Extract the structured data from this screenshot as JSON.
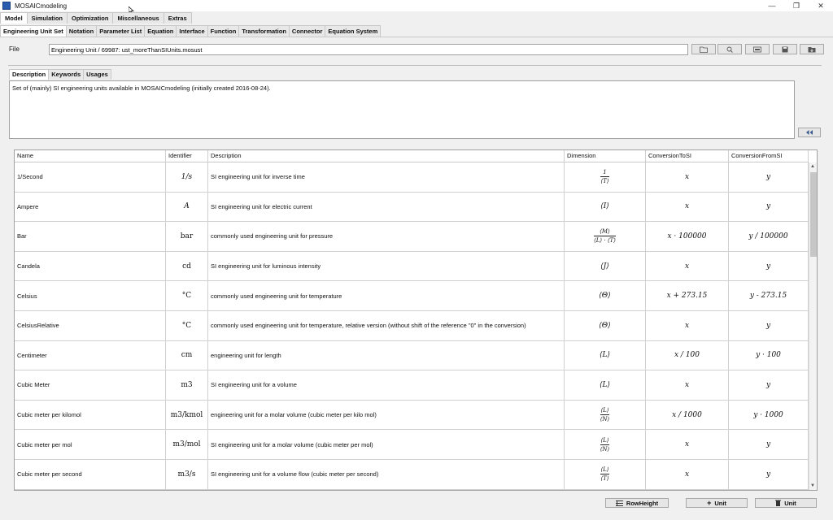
{
  "window": {
    "title": "MOSAICmodeling",
    "minimize": "—",
    "restore": "❐",
    "close": "✕"
  },
  "menu_tabs": [
    "Model",
    "Simulation",
    "Optimization",
    "Miscellaneous",
    "Extras"
  ],
  "sub_tabs": [
    "Engineering Unit Set",
    "Notation",
    "Parameter List",
    "Equation",
    "Interface",
    "Function",
    "Transformation",
    "Connector",
    "Equation System"
  ],
  "file": {
    "label": "File",
    "value": "Engineering Unit / 69987: ust_moreThanSIUnits.mosust"
  },
  "desc_tabs": [
    "Description",
    "Keywords",
    "Usages"
  ],
  "description": "Set of (mainly) SI engineering units available in MOSAICmodeling (initially created 2016-08-24).",
  "table": {
    "headers": [
      "Name",
      "Identifier",
      "Description",
      "Dimension",
      "ConversionToSI",
      "ConversionFromSI"
    ],
    "rows": [
      {
        "name": "1/Second",
        "identifier": "1/s",
        "description": "SI engineering unit for inverse time",
        "to_si": "x",
        "from_si": "y"
      },
      {
        "name": "Ampere",
        "identifier": "A",
        "description": "SI engineering unit for electric current",
        "to_si": "x",
        "from_si": "y"
      },
      {
        "name": "Bar",
        "identifier": "bar",
        "description": "commonly used engineering unit for pressure",
        "to_si": "x · 100000",
        "from_si": "y / 100000"
      },
      {
        "name": "Candela",
        "identifier": "cd",
        "description": "SI engineering unit for luminous intensity",
        "to_si": "x",
        "from_si": "y"
      },
      {
        "name": "Celsius",
        "identifier": "°C",
        "description": "commonly used engineering unit for temperature",
        "to_si": "x + 273.15",
        "from_si": "y - 273.15"
      },
      {
        "name": "CelsiusRelative",
        "identifier": "°C",
        "description": "commonly used engineering unit for temperature, relative version (without shift of the reference \"0\" in the conversion)",
        "to_si": "x",
        "from_si": "y"
      },
      {
        "name": "Centimeter",
        "identifier": "cm",
        "description": "engineering unit for length",
        "to_si": "x / 100",
        "from_si": "y · 100"
      },
      {
        "name": "Cubic Meter",
        "identifier": "m3",
        "description": "SI engineering unit for a volume",
        "to_si": "x",
        "from_si": "y"
      },
      {
        "name": "Cubic meter per kilomol",
        "identifier": "m3/kmol",
        "description": "engineering unit for a molar volume (cubic meter per kilo mol)",
        "to_si": "x / 1000",
        "from_si": "y · 1000"
      },
      {
        "name": "Cubic meter per mol",
        "identifier": "m3/mol",
        "description": "SI engineering unit for a molar volume (cubic meter per mol)",
        "to_si": "x",
        "from_si": "y"
      },
      {
        "name": "Cubic meter per second",
        "identifier": "m3/s",
        "description": "SI engineering unit for a volume flow (cubic meter per second)",
        "to_si": "x",
        "from_si": "y"
      }
    ],
    "dimensions": {
      "r0": {
        "num": "1",
        "den": "⟨T⟩"
      },
      "r1": "⟨I⟩",
      "r2": {
        "num": "⟨M⟩",
        "den": "⟨L⟩ · ⟨T⟩"
      },
      "r3": "⟨J⟩",
      "r4": "⟨Θ⟩",
      "r5": "⟨Θ⟩",
      "r6": "⟨L⟩",
      "r7": "⟨L⟩",
      "r8": {
        "num": "⟨L⟩",
        "den": "⟨N⟩"
      },
      "r9": {
        "num": "⟨L⟩",
        "den": "⟨N⟩"
      },
      "r10": {
        "num": "⟨L⟩",
        "den": "⟨T⟩"
      }
    }
  },
  "buttons": {
    "row_height": "RowHeight",
    "add_unit": "Unit",
    "delete_unit": "Unit"
  }
}
